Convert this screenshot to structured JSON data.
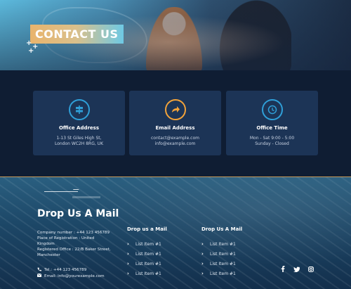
{
  "hero": {
    "title": "CONTACT US"
  },
  "cards": [
    {
      "icon": "signpost-icon",
      "title": "Office Address",
      "lines": [
        "1-13 St Giles High St,",
        "London WC2H 8RG, UK"
      ]
    },
    {
      "icon": "share-arrow-icon",
      "title": "Email Address",
      "lines": [
        "contact@example.com",
        "info@example.com"
      ]
    },
    {
      "icon": "clock-icon",
      "title": "Office Time",
      "lines": [
        "Mon - Sat 9:00 - 5:00",
        "Sunday - Closed"
      ]
    }
  ],
  "footer": {
    "title": "Drop Us A Mail",
    "info": {
      "company": "Company number : +44 123 456789",
      "registration_1": "Place of Registration : United",
      "registration_2": "Kingdom",
      "office_1": "Registered Office : 22/B Baker Street,",
      "office_2": "Manchester"
    },
    "tel": "Tel.: +44 123 456789",
    "email": "Email: info@yourexample.com",
    "columns": [
      {
        "title": "Drop us a Mail",
        "items": [
          "List Item #1",
          "List Item #1",
          "List Item #1",
          "List Item #1"
        ]
      },
      {
        "title": "Drop Us A Mail",
        "items": [
          "List Item #1",
          "List Item #1",
          "List Item #1",
          "List Item #1"
        ]
      }
    ],
    "socials": [
      "facebook-icon",
      "twitter-icon",
      "instagram-icon"
    ]
  },
  "colors": {
    "card_bg": "#1c3456",
    "accent_blue": "#2f9fd8",
    "accent_orange": "#f2a33a",
    "page_bg": "#0f1d33"
  }
}
